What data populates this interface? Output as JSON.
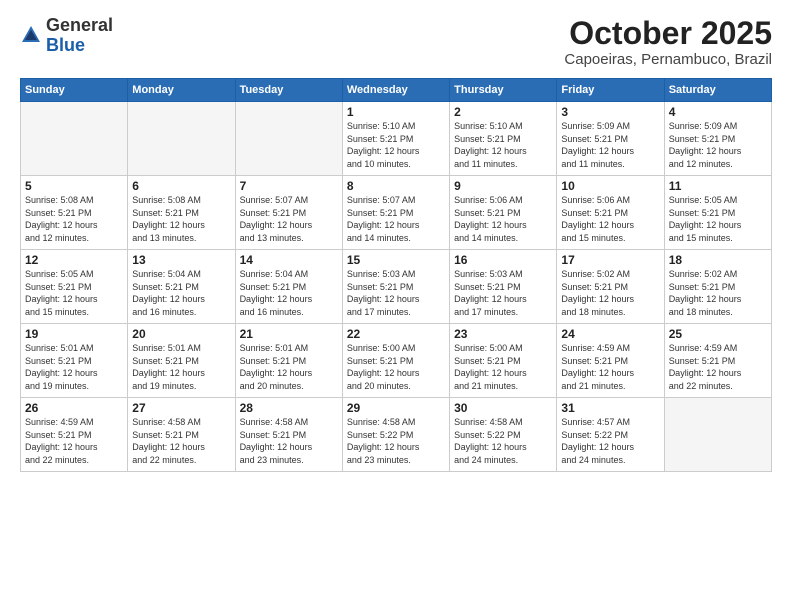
{
  "logo": {
    "general": "General",
    "blue": "Blue"
  },
  "header": {
    "month": "October 2025",
    "location": "Capoeiras, Pernambuco, Brazil"
  },
  "weekdays": [
    "Sunday",
    "Monday",
    "Tuesday",
    "Wednesday",
    "Thursday",
    "Friday",
    "Saturday"
  ],
  "weeks": [
    [
      {
        "day": "",
        "info": ""
      },
      {
        "day": "",
        "info": ""
      },
      {
        "day": "",
        "info": ""
      },
      {
        "day": "1",
        "info": "Sunrise: 5:10 AM\nSunset: 5:21 PM\nDaylight: 12 hours\nand 10 minutes."
      },
      {
        "day": "2",
        "info": "Sunrise: 5:10 AM\nSunset: 5:21 PM\nDaylight: 12 hours\nand 11 minutes."
      },
      {
        "day": "3",
        "info": "Sunrise: 5:09 AM\nSunset: 5:21 PM\nDaylight: 12 hours\nand 11 minutes."
      },
      {
        "day": "4",
        "info": "Sunrise: 5:09 AM\nSunset: 5:21 PM\nDaylight: 12 hours\nand 12 minutes."
      }
    ],
    [
      {
        "day": "5",
        "info": "Sunrise: 5:08 AM\nSunset: 5:21 PM\nDaylight: 12 hours\nand 12 minutes."
      },
      {
        "day": "6",
        "info": "Sunrise: 5:08 AM\nSunset: 5:21 PM\nDaylight: 12 hours\nand 13 minutes."
      },
      {
        "day": "7",
        "info": "Sunrise: 5:07 AM\nSunset: 5:21 PM\nDaylight: 12 hours\nand 13 minutes."
      },
      {
        "day": "8",
        "info": "Sunrise: 5:07 AM\nSunset: 5:21 PM\nDaylight: 12 hours\nand 14 minutes."
      },
      {
        "day": "9",
        "info": "Sunrise: 5:06 AM\nSunset: 5:21 PM\nDaylight: 12 hours\nand 14 minutes."
      },
      {
        "day": "10",
        "info": "Sunrise: 5:06 AM\nSunset: 5:21 PM\nDaylight: 12 hours\nand 15 minutes."
      },
      {
        "day": "11",
        "info": "Sunrise: 5:05 AM\nSunset: 5:21 PM\nDaylight: 12 hours\nand 15 minutes."
      }
    ],
    [
      {
        "day": "12",
        "info": "Sunrise: 5:05 AM\nSunset: 5:21 PM\nDaylight: 12 hours\nand 15 minutes."
      },
      {
        "day": "13",
        "info": "Sunrise: 5:04 AM\nSunset: 5:21 PM\nDaylight: 12 hours\nand 16 minutes."
      },
      {
        "day": "14",
        "info": "Sunrise: 5:04 AM\nSunset: 5:21 PM\nDaylight: 12 hours\nand 16 minutes."
      },
      {
        "day": "15",
        "info": "Sunrise: 5:03 AM\nSunset: 5:21 PM\nDaylight: 12 hours\nand 17 minutes."
      },
      {
        "day": "16",
        "info": "Sunrise: 5:03 AM\nSunset: 5:21 PM\nDaylight: 12 hours\nand 17 minutes."
      },
      {
        "day": "17",
        "info": "Sunrise: 5:02 AM\nSunset: 5:21 PM\nDaylight: 12 hours\nand 18 minutes."
      },
      {
        "day": "18",
        "info": "Sunrise: 5:02 AM\nSunset: 5:21 PM\nDaylight: 12 hours\nand 18 minutes."
      }
    ],
    [
      {
        "day": "19",
        "info": "Sunrise: 5:01 AM\nSunset: 5:21 PM\nDaylight: 12 hours\nand 19 minutes."
      },
      {
        "day": "20",
        "info": "Sunrise: 5:01 AM\nSunset: 5:21 PM\nDaylight: 12 hours\nand 19 minutes."
      },
      {
        "day": "21",
        "info": "Sunrise: 5:01 AM\nSunset: 5:21 PM\nDaylight: 12 hours\nand 20 minutes."
      },
      {
        "day": "22",
        "info": "Sunrise: 5:00 AM\nSunset: 5:21 PM\nDaylight: 12 hours\nand 20 minutes."
      },
      {
        "day": "23",
        "info": "Sunrise: 5:00 AM\nSunset: 5:21 PM\nDaylight: 12 hours\nand 21 minutes."
      },
      {
        "day": "24",
        "info": "Sunrise: 4:59 AM\nSunset: 5:21 PM\nDaylight: 12 hours\nand 21 minutes."
      },
      {
        "day": "25",
        "info": "Sunrise: 4:59 AM\nSunset: 5:21 PM\nDaylight: 12 hours\nand 22 minutes."
      }
    ],
    [
      {
        "day": "26",
        "info": "Sunrise: 4:59 AM\nSunset: 5:21 PM\nDaylight: 12 hours\nand 22 minutes."
      },
      {
        "day": "27",
        "info": "Sunrise: 4:58 AM\nSunset: 5:21 PM\nDaylight: 12 hours\nand 22 minutes."
      },
      {
        "day": "28",
        "info": "Sunrise: 4:58 AM\nSunset: 5:21 PM\nDaylight: 12 hours\nand 23 minutes."
      },
      {
        "day": "29",
        "info": "Sunrise: 4:58 AM\nSunset: 5:22 PM\nDaylight: 12 hours\nand 23 minutes."
      },
      {
        "day": "30",
        "info": "Sunrise: 4:58 AM\nSunset: 5:22 PM\nDaylight: 12 hours\nand 24 minutes."
      },
      {
        "day": "31",
        "info": "Sunrise: 4:57 AM\nSunset: 5:22 PM\nDaylight: 12 hours\nand 24 minutes."
      },
      {
        "day": "",
        "info": ""
      }
    ]
  ]
}
